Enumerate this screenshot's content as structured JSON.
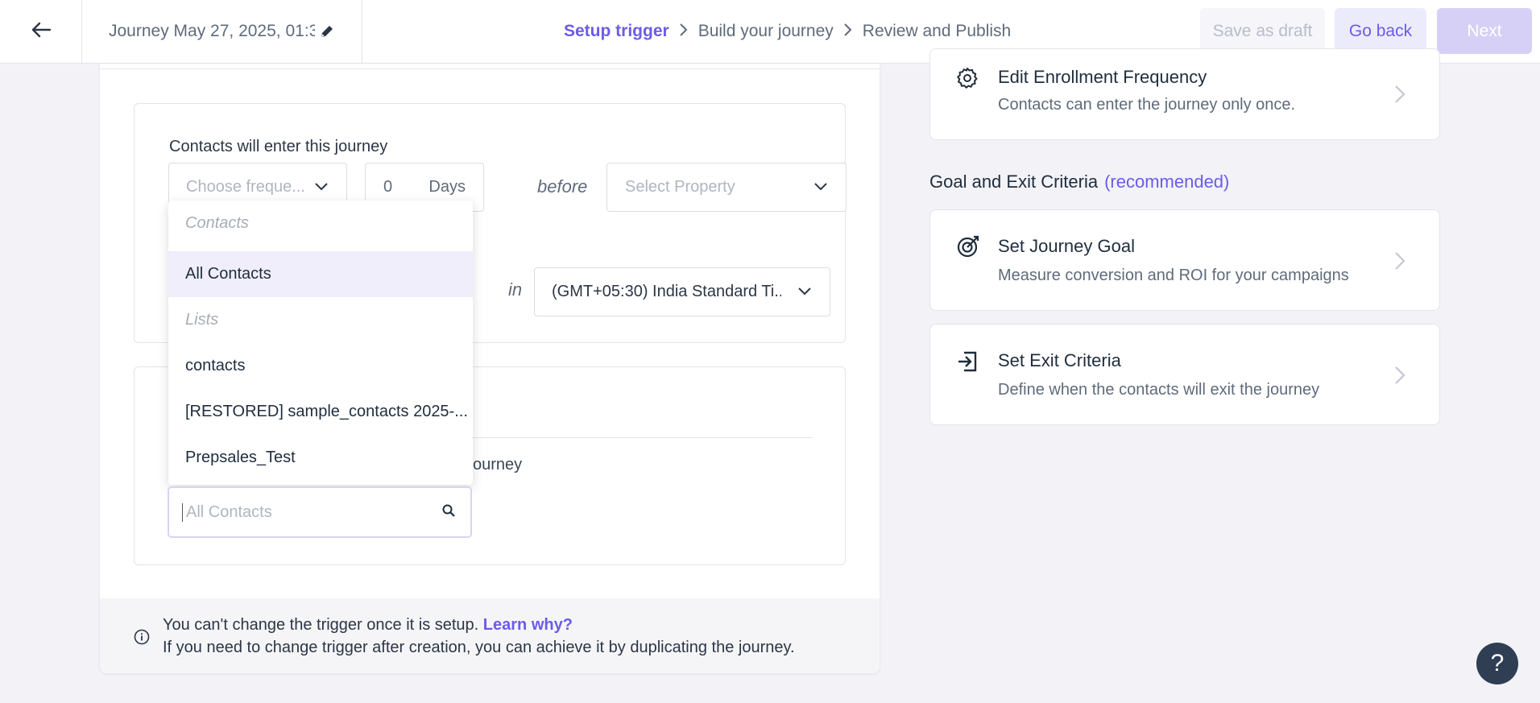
{
  "header": {
    "title": "Journey May 27, 2025, 01:3",
    "steps": [
      "Setup trigger",
      "Build your journey",
      "Review and Publish"
    ],
    "save_draft_label": "Save as draft",
    "go_back_label": "Go back",
    "next_label": "Next"
  },
  "trigger": {
    "enter_label": "Contacts will enter this journey",
    "frequency_placeholder": "Choose freque...",
    "days_value": "0",
    "days_unit": "Days",
    "before_text": "before",
    "property_placeholder": "Select Property",
    "in_text": "in",
    "timezone_value": "(GMT+05:30) India Standard Ti..."
  },
  "segment": {
    "partial_text": "ourney",
    "search_placeholder": "All Contacts"
  },
  "dropdown": {
    "group_contacts": "Contacts",
    "opt_all_contacts": "All Contacts",
    "group_lists": "Lists",
    "opt_contacts": "contacts",
    "opt_restored": "[RESTORED] sample_contacts 2025-...",
    "opt_prepsales": "Prepsales_Test"
  },
  "info": {
    "line1": "You can't change the trigger once it is setup.",
    "learn_link": "Learn why?",
    "line2": "If you need to change trigger after creation, you can achieve it by duplicating the journey."
  },
  "right": {
    "enrollment_title": "Edit Enrollment Frequency",
    "enrollment_desc": "Contacts can enter the journey only once.",
    "section_heading": "Goal and Exit Criteria",
    "section_rec": "(recommended)",
    "goal_title": "Set Journey Goal",
    "goal_desc": "Measure conversion and ROI for your campaigns",
    "exit_title": "Set Exit Criteria",
    "exit_desc": "Define when the contacts will exit the journey"
  },
  "help_label": "?",
  "colors": {
    "accent": "#6b5ce7",
    "next_disabled": "#d6d0f6",
    "help_bg": "#2f3e53"
  }
}
